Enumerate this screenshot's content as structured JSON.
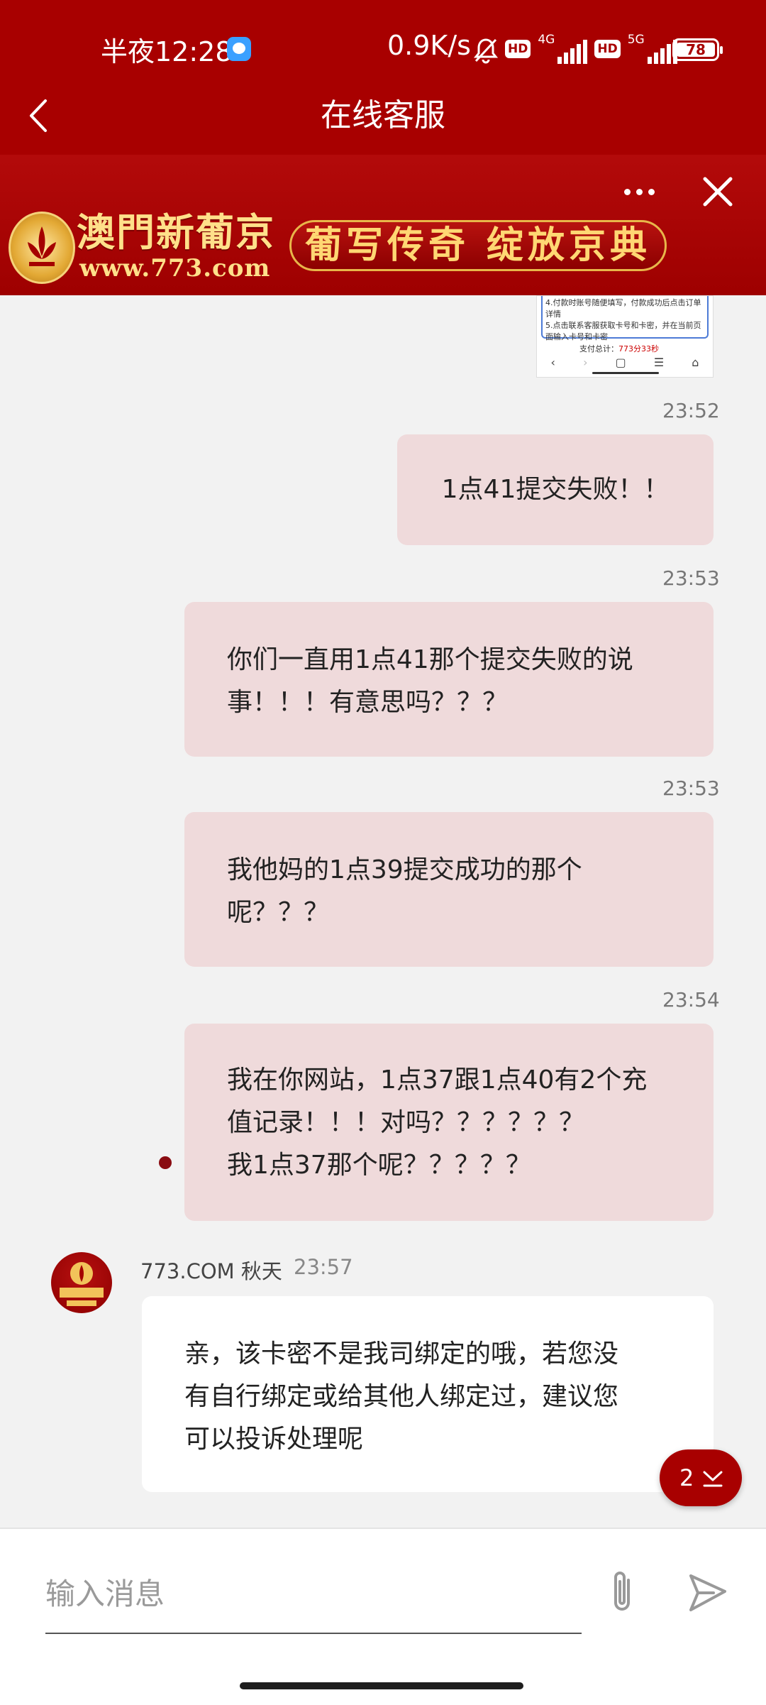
{
  "status_bar": {
    "time": "半夜12:28",
    "speed": "0.9K/s",
    "hd1": "HD",
    "net1": "4G",
    "hd2": "HD",
    "net2": "5G",
    "battery": "78"
  },
  "header": {
    "title": "在线客服",
    "back_icon": "chevron-left-icon"
  },
  "banner": {
    "brand": "澳門新葡京",
    "url": "www.773.com",
    "slogan": "葡写传奇 绽放京典",
    "more_icon": "more-icon",
    "close_icon": "close-icon"
  },
  "thumbnail": {
    "line1": "4.付款时账号随便填写，付款成功后点击订单详情",
    "line2": "5.点击联系客服获取卡号和卡密，并在当前页面输入卡号和卡密",
    "foot_label": "支付总计：",
    "foot_value": "773分33秒"
  },
  "messages": [
    {
      "type": "out",
      "time": "23:52",
      "text": "1点41提交失败！！"
    },
    {
      "type": "out",
      "time": "23:53",
      "lines": [
        "你们一直用1点41那个提交失败的说",
        "事！！！有意思吗？？？"
      ]
    },
    {
      "type": "out",
      "time": "23:53",
      "lines": [
        "我他妈的1点39提交成功的那个",
        "呢？？？"
      ]
    },
    {
      "type": "out",
      "time": "23:54",
      "lines": [
        "我在你网站，1点37跟1点40有2个充",
        "值记录！！！对吗？？？？？？",
        "我1点37那个呢？？？？？"
      ]
    },
    {
      "type": "in",
      "sender": "773.COM 秋天",
      "time": "23:57",
      "lines": [
        "亲，该卡密不是我司绑定的哦，若您没",
        "有自行绑定或给其他人绑定过，建议您",
        "可以投诉处理呢"
      ]
    }
  ],
  "scroll_down": {
    "count": "2"
  },
  "composer": {
    "placeholder": "输入消息",
    "attach_icon": "paperclip-icon",
    "send_icon": "send-icon"
  },
  "colors": {
    "brand_red": "#a80000",
    "bubble_out": "#efdadb",
    "bubble_in": "#ffffff",
    "gold": "#ffe08a"
  }
}
